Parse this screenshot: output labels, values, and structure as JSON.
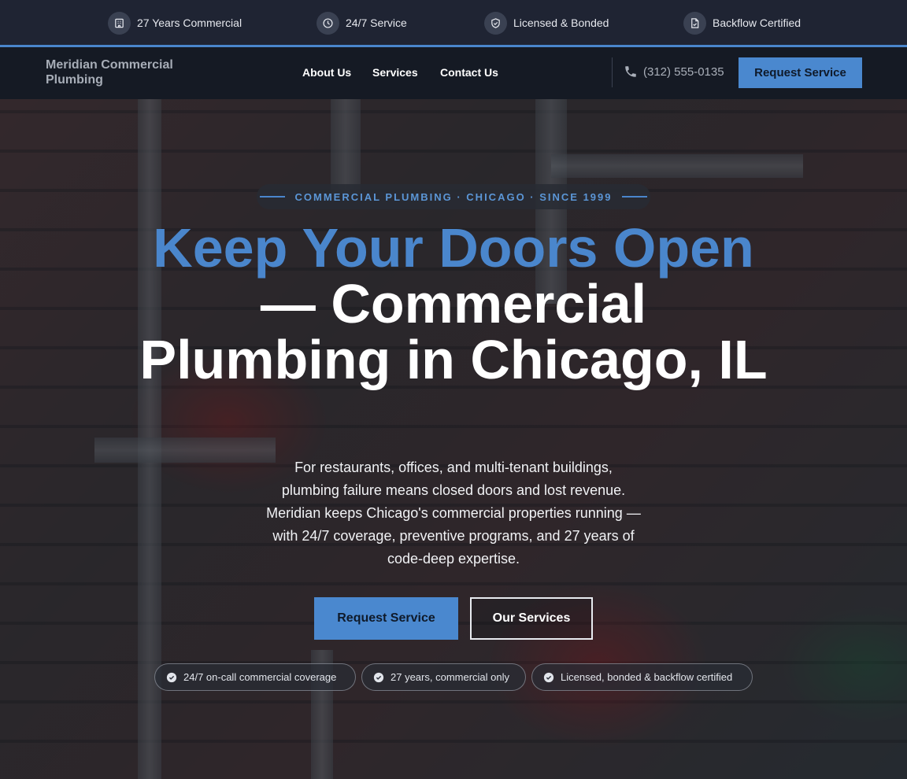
{
  "topbar": {
    "items": [
      {
        "label": "27 Years Commercial",
        "icon": "building-icon"
      },
      {
        "label": "24/7 Service",
        "icon": "clock-icon"
      },
      {
        "label": "Licensed & Bonded",
        "icon": "shield-check-icon"
      },
      {
        "label": "Backflow Certified",
        "icon": "document-check-icon"
      }
    ]
  },
  "nav": {
    "brand": "Meridian Commercial Plumbing",
    "links": [
      "About Us",
      "Services",
      "Contact Us"
    ],
    "phone": "(312) 555-0135",
    "cta": "Request Service"
  },
  "hero": {
    "eyebrow": "COMMERCIAL PLUMBING · CHICAGO · SINCE 1999",
    "headline_highlight": "Keep Your Doors Open",
    "headline_rest": " — Commercial Plumbing in Chicago, IL",
    "lead": "For restaurants, offices, and multi-tenant buildings, plumbing failure means closed doors and lost revenue. Meridian keeps Chicago's commercial properties running — with 24/7 coverage, preventive programs, and 27 years of code-deep expertise.",
    "primary_cta": "Request Service",
    "secondary_cta": "Our Services",
    "badges": [
      "24/7 on-call commercial coverage",
      "27 years, commercial only",
      "Licensed, bonded & backflow certified"
    ]
  },
  "colors": {
    "accent": "#4a88cf",
    "topbar_bg": "#1f2433",
    "nav_bg": "#151a24"
  }
}
